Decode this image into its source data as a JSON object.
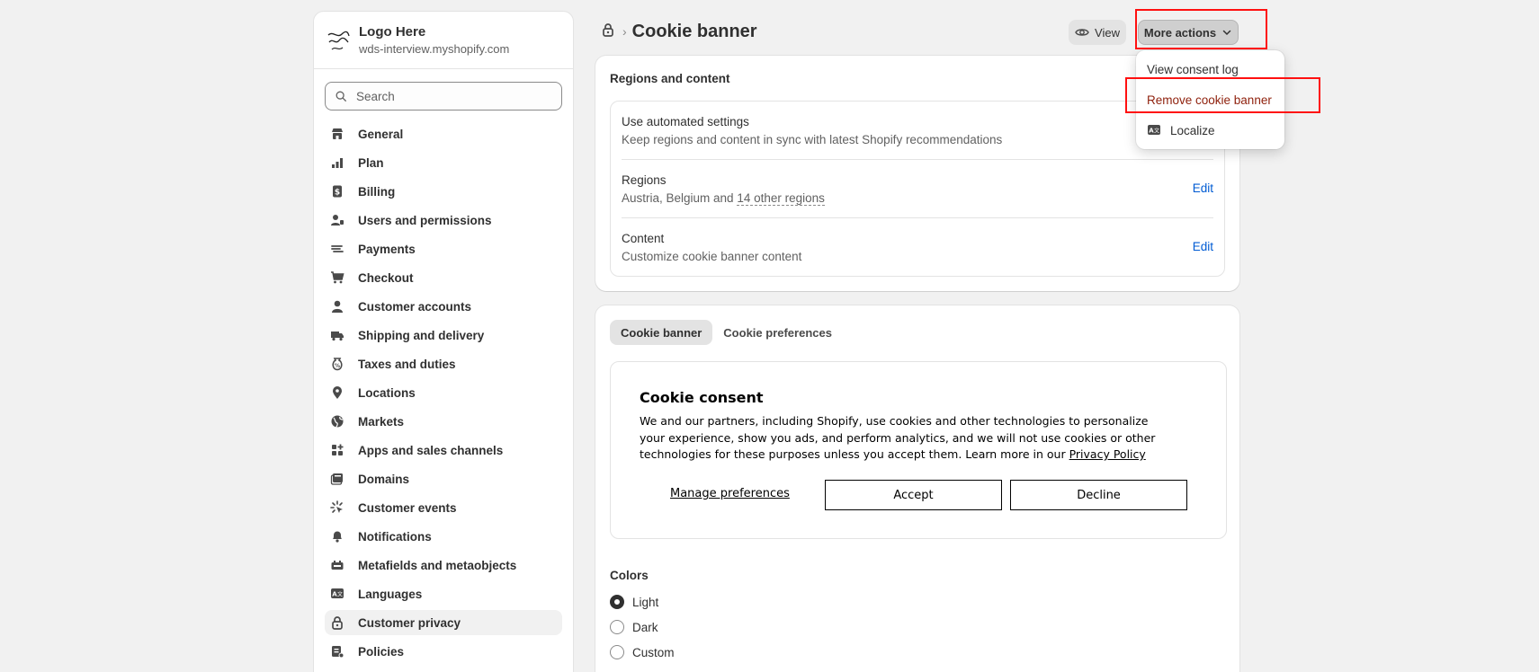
{
  "store": {
    "logo_text": "Logo Here",
    "name": "Logo Here",
    "domain": "wds-interview.myshopify.com"
  },
  "search": {
    "placeholder": "Search"
  },
  "nav": {
    "items": [
      {
        "label": "General",
        "icon": "store-icon"
      },
      {
        "label": "Plan",
        "icon": "plan-icon"
      },
      {
        "label": "Billing",
        "icon": "billing-icon"
      },
      {
        "label": "Users and permissions",
        "icon": "users-icon"
      },
      {
        "label": "Payments",
        "icon": "payments-icon"
      },
      {
        "label": "Checkout",
        "icon": "cart-icon"
      },
      {
        "label": "Customer accounts",
        "icon": "person-icon"
      },
      {
        "label": "Shipping and delivery",
        "icon": "truck-icon"
      },
      {
        "label": "Taxes and duties",
        "icon": "tax-icon"
      },
      {
        "label": "Locations",
        "icon": "location-icon"
      },
      {
        "label": "Markets",
        "icon": "globe-icon"
      },
      {
        "label": "Apps and sales channels",
        "icon": "apps-icon"
      },
      {
        "label": "Domains",
        "icon": "domains-icon"
      },
      {
        "label": "Customer events",
        "icon": "events-icon"
      },
      {
        "label": "Notifications",
        "icon": "bell-icon"
      },
      {
        "label": "Metafields and metaobjects",
        "icon": "metafields-icon"
      },
      {
        "label": "Languages",
        "icon": "language-icon"
      },
      {
        "label": "Customer privacy",
        "icon": "lock-icon",
        "active": true
      },
      {
        "label": "Policies",
        "icon": "policies-icon"
      }
    ]
  },
  "header": {
    "separator": "›",
    "title": "Cookie banner",
    "view_label": "View",
    "more_actions_label": "More actions"
  },
  "menu": {
    "items": [
      {
        "label": "View consent log"
      },
      {
        "label": "Remove cookie banner"
      },
      {
        "label": "Localize",
        "icon": "translate-icon"
      }
    ]
  },
  "regions_card": {
    "title": "Regions and content",
    "automated": {
      "title": "Use automated settings",
      "subtitle": "Keep regions and content in sync with latest Shopify recommendations"
    },
    "regions": {
      "title": "Regions",
      "subtitle_prefix": "Austria, Belgium and ",
      "subtitle_link": "14 other regions",
      "edit": "Edit"
    },
    "content": {
      "title": "Content",
      "subtitle": "Customize cookie banner content",
      "edit": "Edit"
    }
  },
  "preview_card": {
    "tabs": [
      "Cookie banner",
      "Cookie preferences"
    ],
    "consent": {
      "title": "Cookie consent",
      "body_line1": "We and our partners, including Shopify, use cookies and other technologies to personalize",
      "body_line2": "your experience, show you ads, and perform analytics, and we will not use cookies or other",
      "body_line3": "technologies for these purposes unless you accept them. Learn more in our ",
      "privacy_link": "Privacy Policy",
      "manage": "Manage preferences",
      "accept": "Accept",
      "decline": "Decline"
    },
    "colors": {
      "title": "Colors",
      "options": [
        {
          "label": "Light",
          "checked": true
        },
        {
          "label": "Dark",
          "checked": false
        },
        {
          "label": "Custom",
          "checked": false
        }
      ]
    }
  },
  "colors": {
    "highlight": "#ff1010",
    "link": "#005bd3",
    "danger": "#8e1f0b"
  }
}
